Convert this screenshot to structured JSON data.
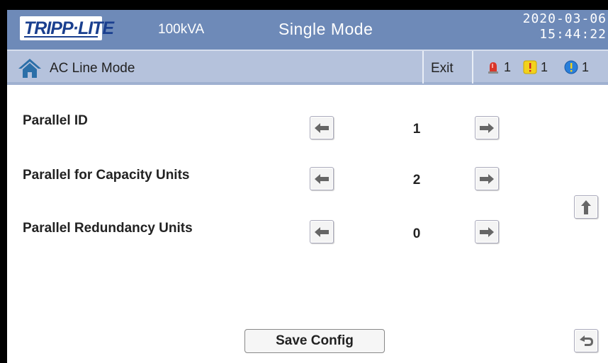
{
  "header": {
    "brand": "TRIPP·LITE",
    "capacity": "100kVA",
    "mode": "Single Mode",
    "date": "2020-03-06",
    "time": "15:44:22"
  },
  "status": {
    "title": "AC Line Mode",
    "exit_label": "Exit",
    "alarms": [
      {
        "icon": "red-siren-icon",
        "count": "1",
        "color": "#d9362a"
      },
      {
        "icon": "yellow-warning-icon",
        "count": "1",
        "color": "#f2d21c"
      },
      {
        "icon": "blue-info-icon",
        "count": "1",
        "color": "#2a7fd9"
      }
    ]
  },
  "settings": [
    {
      "label": "Parallel ID",
      "value": "1"
    },
    {
      "label": "Parallel for Capacity Units",
      "value": "2"
    },
    {
      "label": "Parallel Redundancy Units",
      "value": "0"
    }
  ],
  "footer": {
    "save_label": "Save Config"
  },
  "colors": {
    "header_bg": "#6e8ab8",
    "status_bg": "#b5c2dc",
    "brand": "#1a3f8f"
  }
}
